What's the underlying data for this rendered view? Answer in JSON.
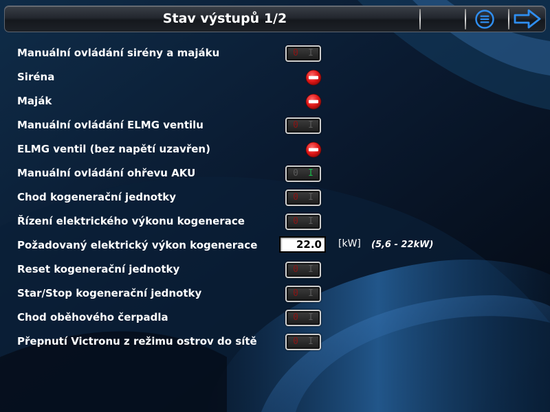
{
  "header": {
    "title": "Stav výstupů 1/2",
    "menu_icon": "list-menu-icon",
    "next_icon": "arrow-right-icon"
  },
  "colors": {
    "header_text": "#ffffff",
    "toggle_off_digit": "#8a1414",
    "toggle_on_digit": "#19b84a",
    "indicator_red": "#e01616"
  },
  "rows": [
    {
      "label": "Manuální ovládání sirény a majáku",
      "type": "toggle",
      "left": "0",
      "right": "I",
      "state": "off"
    },
    {
      "label": "Siréna",
      "type": "indicator",
      "icon": "no-entry-icon"
    },
    {
      "label": "Maják",
      "type": "indicator",
      "icon": "no-entry-icon"
    },
    {
      "label": "Manuální ovládání ELMG ventilu",
      "type": "toggle",
      "left": "0",
      "right": "I",
      "state": "off"
    },
    {
      "label": "ELMG ventil (bez napětí uzavřen)",
      "type": "indicator",
      "icon": "no-entry-icon"
    },
    {
      "label": "Manuální ovládání ohřevu AKU",
      "type": "toggle",
      "left": "0",
      "right": "I",
      "state": "on"
    },
    {
      "label": "Chod kogenerační jednotky",
      "type": "toggle",
      "left": "0",
      "right": "I",
      "state": "off"
    },
    {
      "label": "Řízení elektrického výkonu kogenerace",
      "type": "toggle",
      "left": "0",
      "right": "I",
      "state": "off"
    },
    {
      "label": "Požadovaný elektrický výkon kogenerace",
      "type": "input",
      "value": "22.0",
      "unit": "[kW]",
      "range": "(5,6 - 22kW)"
    },
    {
      "label": "Reset kogenerační jednotky",
      "type": "toggle",
      "left": "0",
      "right": "I",
      "state": "off"
    },
    {
      "label": "Star/Stop kogenerační jednotky",
      "type": "toggle",
      "left": "0",
      "right": "I",
      "state": "off"
    },
    {
      "label": "Chod oběhového čerpadla",
      "type": "toggle",
      "left": "0",
      "right": "I",
      "state": "off"
    },
    {
      "label": "Přepnutí Victronu z režimu ostrov do sítě",
      "type": "toggle",
      "left": "0",
      "right": "I",
      "state": "off"
    }
  ]
}
